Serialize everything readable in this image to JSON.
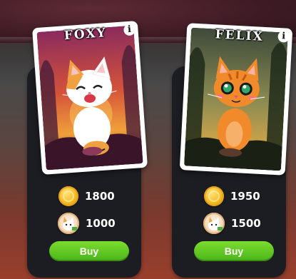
{
  "cards": [
    {
      "name": "FOXY",
      "info_label": "i",
      "price_coins": "1800",
      "price_tokens": "1000",
      "buy_label": "Buy"
    },
    {
      "name": "FELIX",
      "info_label": "i",
      "price_coins": "1950",
      "price_tokens": "1500",
      "buy_label": "Buy"
    }
  ],
  "icons": {
    "coin": "gold-coin-icon",
    "token": "cat-token-icon",
    "info": "info-icon"
  },
  "colors": {
    "panel": "#1c1d22",
    "buy_button": "#5cc521",
    "coin": "#f5b91f"
  }
}
